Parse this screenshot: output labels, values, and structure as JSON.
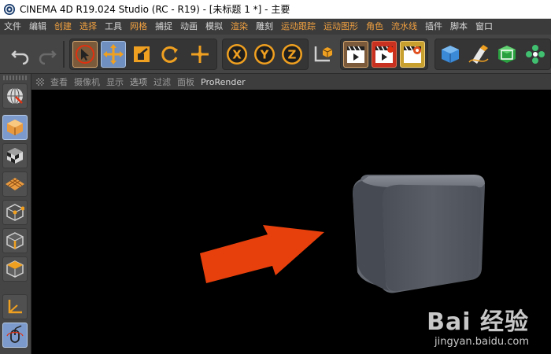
{
  "window": {
    "title": "CINEMA 4D R19.024 Studio (RC - R19) - [未标题 1 *] - 主要"
  },
  "menu": {
    "items": [
      "文件",
      "编辑",
      "创建",
      "选择",
      "工具",
      "网格",
      "捕捉",
      "动画",
      "模拟",
      "渲染",
      "雕刻",
      "运动跟踪",
      "运动图形",
      "角色",
      "流水线",
      "插件",
      "脚本",
      "窗口"
    ]
  },
  "toolbar": {
    "icons": [
      "undo-icon",
      "redo-icon",
      "live-selection-icon",
      "move-icon",
      "scale-icon",
      "rotate-icon",
      "add-axis-icon",
      "x-axis-lock-icon",
      "y-axis-lock-icon",
      "z-axis-lock-icon",
      "coordinate-system-icon",
      "render-view-icon",
      "render-to-picture-viewer-icon",
      "render-settings-icon",
      "cube-icon",
      "pen-icon",
      "subdivision-surface-icon",
      "cloner-icon"
    ]
  },
  "palette": {
    "icons": [
      "world-globe-icon",
      "model-mode-icon",
      "texture-mode-icon",
      "workplane-icon",
      "points-mode-icon",
      "edges-mode-icon",
      "polygons-mode-icon",
      "axis-mode-icon",
      "tweak-mode-icon"
    ]
  },
  "viewport_menu": {
    "items": [
      "查看",
      "摄像机",
      "显示",
      "选项",
      "过滤",
      "面板",
      "ProRender"
    ]
  },
  "watermark": {
    "logo": "Bai 经验",
    "url": "jingyan.baidu.com"
  },
  "colors": {
    "accent_orange": "#f0a040",
    "arrow": "#e8400c",
    "cube": "#5a5e66"
  }
}
